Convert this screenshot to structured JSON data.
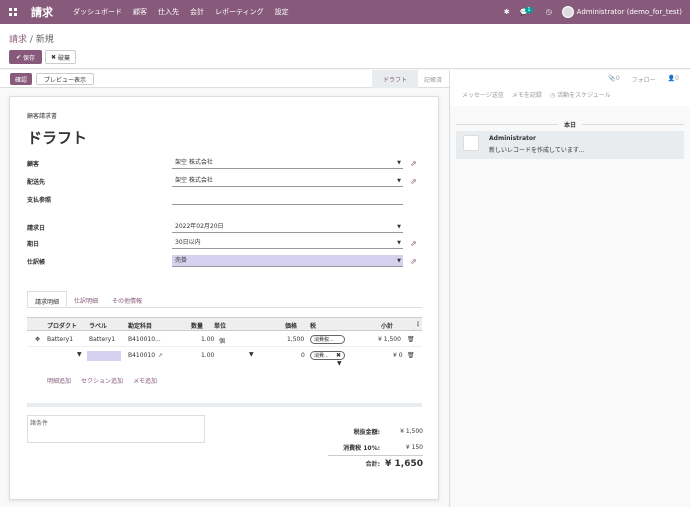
{
  "topbar": {
    "app_name": "請求",
    "menu": [
      "ダッシュボード",
      "顧客",
      "仕入先",
      "会計",
      "レポーティング",
      "設定"
    ],
    "user_label": "Administrator (demo_for_test)",
    "notification_count": "1"
  },
  "breadcrumb": {
    "parent": "請求",
    "current": "新規"
  },
  "actions": {
    "save": "保存",
    "discard": "破棄"
  },
  "statusbar": {
    "confirm": "確認",
    "preview": "プレビュー表示",
    "stage_draft": "ドラフト",
    "stage_posted": "記帳済"
  },
  "form": {
    "doc_type": "顧客請求書",
    "title": "ドラフト",
    "fields": {
      "customer": {
        "label": "顧客",
        "value": "架空 株式会社"
      },
      "delivery": {
        "label": "配送先",
        "value": "架空 株式会社"
      },
      "payment_ref": {
        "label": "支払参照",
        "value": ""
      },
      "invoice_date": {
        "label": "請求日",
        "value": "2022年02月20日"
      },
      "due_date": {
        "label": "期日",
        "value": "30日以内"
      },
      "journal": {
        "label": "仕訳帳",
        "value": "売掛"
      }
    },
    "tabs": [
      "請求明細",
      "仕訳明細",
      "その他情報"
    ],
    "lines_header": [
      "プロダクト",
      "ラベル",
      "勘定科目",
      "数量",
      "単位",
      "価格",
      "税",
      "小計"
    ],
    "lines": [
      {
        "product": "Battery1",
        "label": "Battery1",
        "account": "B410010...",
        "qty": "1.00",
        "uom": "個",
        "price": "1,500",
        "tax": "消費税...",
        "subtotal": "¥ 1,500"
      },
      {
        "product": "",
        "label": "",
        "account": "B410010",
        "qty": "1.00",
        "uom": "",
        "price": "0",
        "tax": "消費...",
        "subtotal": "¥ 0"
      }
    ],
    "add_links": [
      "明細追加",
      "セクション追加",
      "メモ追加"
    ],
    "terms_placeholder": "諸条件",
    "totals": {
      "untaxed_label": "税抜金額:",
      "untaxed_value": "¥ 1,500",
      "tax_label": "消費税 10%:",
      "tax_value": "¥ 150",
      "total_label": "合計:",
      "total_value": "¥ 1,650"
    }
  },
  "chatter": {
    "attachments": "0",
    "follow": "フォロー",
    "followers": "0",
    "buttons": [
      "メッセージ送信",
      "メモを記録",
      "活動をスケジュール"
    ],
    "today": "本日",
    "message": {
      "author": "Administrator",
      "body": "新しいレコードを作成しています..."
    }
  }
}
